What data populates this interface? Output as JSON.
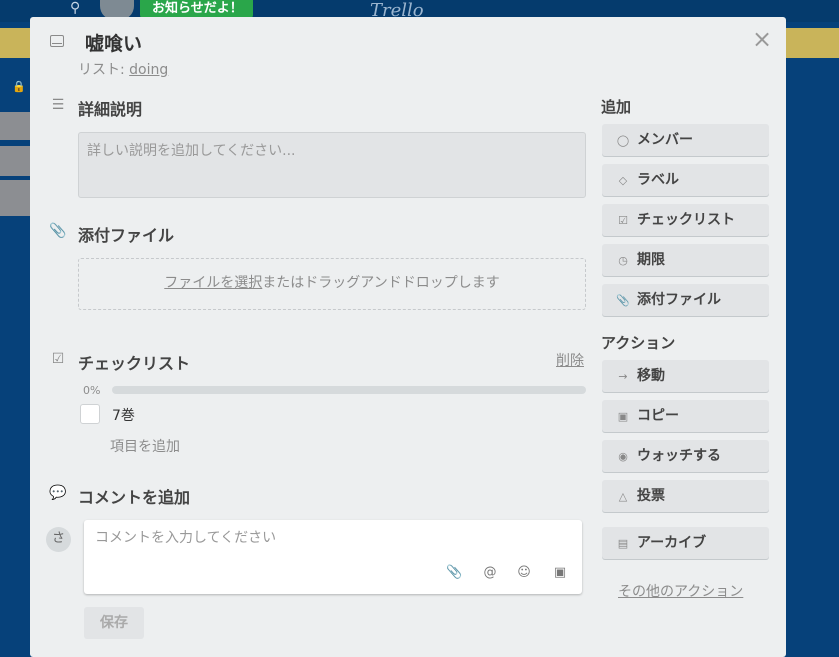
{
  "background": {
    "notice_text": "お知らせだよ！",
    "logo_text": "Trello",
    "search_icon": "search-icon",
    "lock_icon": "lock-icon"
  },
  "card": {
    "title": "嘘喰い",
    "list_prefix": "リスト: ",
    "list_name": "doing",
    "close_glyph": "×"
  },
  "description": {
    "heading": "詳細説明",
    "placeholder": "詳しい説明を追加してください..."
  },
  "attachments": {
    "heading": "添付ファイル",
    "select_link": "ファイルを選択",
    "drop_text": "またはドラッグアンドドロップします"
  },
  "checklist": {
    "heading": "チェックリスト",
    "delete_label": "削除",
    "progress_label": "0%",
    "progress_value": 0,
    "items": [
      {
        "text": "7巻",
        "checked": false
      }
    ],
    "add_item_label": "項目を追加"
  },
  "comment": {
    "heading": "コメントを追加",
    "avatar_initial": "さ",
    "placeholder": "コメントを入力してください",
    "save_label": "保存",
    "toolbar_icons": [
      "attachment-icon",
      "mention-icon",
      "emoji-icon",
      "card-icon"
    ]
  },
  "sidebar": {
    "add_heading": "追加",
    "add_buttons": [
      {
        "label": "メンバー",
        "icon": "member-icon"
      },
      {
        "label": "ラベル",
        "icon": "label-icon"
      },
      {
        "label": "チェックリスト",
        "icon": "checklist-icon"
      },
      {
        "label": "期限",
        "icon": "clock-icon"
      },
      {
        "label": "添付ファイル",
        "icon": "attachment-icon"
      }
    ],
    "actions_heading": "アクション",
    "action_buttons": [
      {
        "label": "移動",
        "icon": "arrow-right-icon"
      },
      {
        "label": "コピー",
        "icon": "card-icon"
      },
      {
        "label": "ウォッチする",
        "icon": "eye-icon"
      },
      {
        "label": "投票",
        "icon": "thumbs-up-icon"
      }
    ],
    "archive_button": {
      "label": "アーカイブ",
      "icon": "archive-icon"
    },
    "other_actions": "その他のアクション"
  }
}
